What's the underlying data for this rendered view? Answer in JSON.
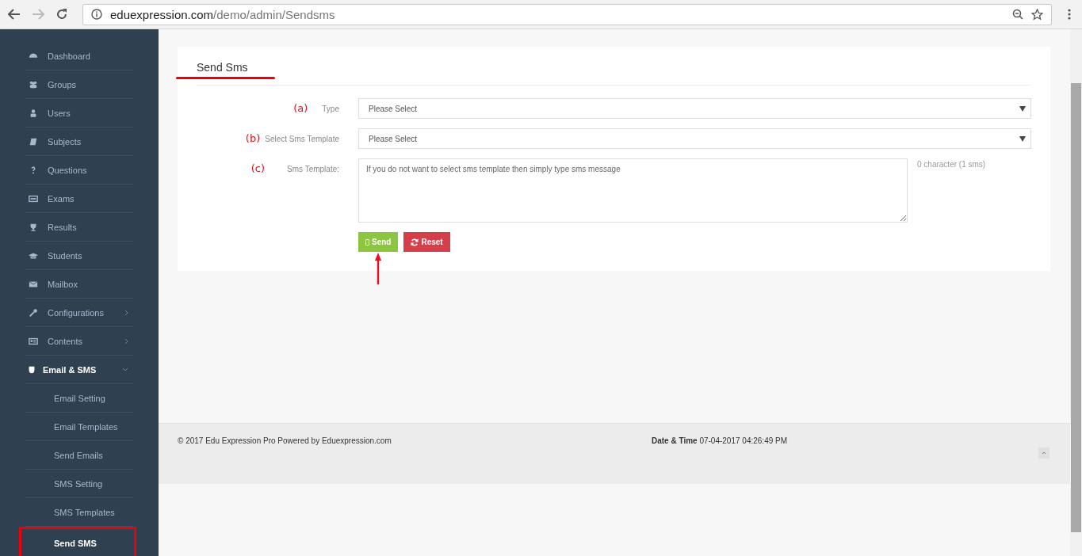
{
  "browser": {
    "url_host": "eduexpression.com",
    "url_path": "/demo/admin/Sendsms"
  },
  "sidebar": {
    "items": [
      {
        "label": "Dashboard"
      },
      {
        "label": "Groups"
      },
      {
        "label": "Users"
      },
      {
        "label": "Subjects"
      },
      {
        "label": "Questions"
      },
      {
        "label": "Exams"
      },
      {
        "label": "Results"
      },
      {
        "label": "Students"
      },
      {
        "label": "Mailbox"
      },
      {
        "label": "Configurations",
        "expanded": false
      },
      {
        "label": "Contents",
        "expanded": false
      },
      {
        "label": "Email & SMS",
        "expanded": true,
        "children": [
          {
            "label": "Email Setting",
            "selected": false
          },
          {
            "label": "Email Templates",
            "selected": false
          },
          {
            "label": "Send Emails",
            "selected": false
          },
          {
            "label": "SMS Setting",
            "selected": false
          },
          {
            "label": "SMS Templates",
            "selected": false
          },
          {
            "label": "Send SMS",
            "selected": true
          }
        ]
      }
    ]
  },
  "page": {
    "title": "Send Sms",
    "fields": [
      {
        "kind": "select",
        "annotation": "(a)",
        "label": "Type",
        "value": "Please Select"
      },
      {
        "kind": "select",
        "annotation": "(b)",
        "label": "Select Sms Template",
        "value": "Please Select"
      },
      {
        "kind": "textarea",
        "annotation": "(c)",
        "label": "Sms Template:",
        "placeholder": "If you do not want to select sms template then simply type sms message",
        "counter": "0 character (1 sms)"
      }
    ],
    "buttons": [
      {
        "kind": "send",
        "label": "Send",
        "arrow": true
      },
      {
        "kind": "reset",
        "label": "Reset",
        "arrow": false
      }
    ]
  },
  "footer": {
    "copyright": "© 2017 Edu Expression Pro Powered by Eduexpression.com",
    "datetime_label": "Date & Time",
    "datetime_value": "07-04-2017 04:26:49 PM"
  }
}
